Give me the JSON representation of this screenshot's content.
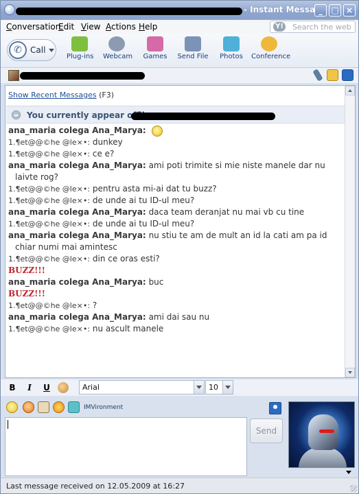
{
  "window": {
    "title": "- Instant Message",
    "controls": {
      "minimize": "_",
      "maximize": "□",
      "close": "×"
    }
  },
  "menu": {
    "items": [
      "Conversation",
      "Edit",
      "View",
      "Actions",
      "Help"
    ],
    "search_placeholder": "Search the web",
    "search_logo": "Y!"
  },
  "toolbar": {
    "call_label": "Call",
    "tools": [
      {
        "label": "Plug-ins",
        "icon": "plugin-icon",
        "color": "#7fbf3f"
      },
      {
        "label": "Webcam",
        "icon": "webcam-icon",
        "color": "#8c9bb0"
      },
      {
        "label": "Games",
        "icon": "games-icon",
        "color": "#d46aa8"
      },
      {
        "label": "Send File",
        "icon": "send-file-icon",
        "color": "#7c93b8"
      },
      {
        "label": "Photos",
        "icon": "photos-icon",
        "color": "#4fb0d8"
      },
      {
        "label": "Conference",
        "icon": "conference-icon",
        "color": "#f0b83a"
      }
    ]
  },
  "conversation": {
    "show_recent_link": "Show Recent Messages",
    "show_recent_key": "(F3)",
    "offline_notice": "You currently appear offli",
    "messages": [
      {
        "sender": "ana_maria colega Ana_Marya:",
        "text": "",
        "smiley": true,
        "who": "them"
      },
      {
        "sender": "1.¶et@@©he @le×•:",
        "text": "dunkey",
        "who": "me"
      },
      {
        "sender": "1.¶et@@©he @le×•:",
        "text": "ce e?",
        "who": "me"
      },
      {
        "sender": "ana_maria colega Ana_Marya:",
        "text": "ami poti trimite si mie niste manele dar nu laivte rog?",
        "who": "them"
      },
      {
        "sender": "1.¶et@@©he @le×•:",
        "text": "pentru asta mi-ai dat tu buzz?",
        "who": "me"
      },
      {
        "sender": "1.¶et@@©he @le×•:",
        "text": "de unde ai tu ID-ul meu?",
        "who": "me"
      },
      {
        "sender": "ana_maria colega Ana_Marya:",
        "text": "daca team deranjat nu mai vb cu tine",
        "who": "them"
      },
      {
        "sender": "1.¶et@@©he @le×•:",
        "text": "de unde ai tu ID-ul meu?",
        "who": "me"
      },
      {
        "sender": "ana_maria colega Ana_Marya:",
        "text": "nu stiu te am de mult an id la cati am pa id chiar numi mai amintesc",
        "who": "them"
      },
      {
        "sender": "1.¶et@@©he @le×•:",
        "text": "din ce oras esti?",
        "who": "me"
      },
      {
        "buzz": "BUZZ!!!"
      },
      {
        "sender": "ana_maria colega Ana_Marya:",
        "text": "buc",
        "who": "them"
      },
      {
        "buzz": "BUZZ!!!"
      },
      {
        "sender": "1.¶et@@©he @le×•:",
        "text": "?",
        "who": "me"
      },
      {
        "sender": "ana_maria colega Ana_Marya:",
        "text": "ami dai sau nu",
        "who": "them"
      },
      {
        "sender": "1.¶et@@©he @le×•:",
        "text": "nu ascult manele",
        "who": "me"
      }
    ]
  },
  "format": {
    "bold": "B",
    "italic": "I",
    "underline": "U",
    "font": "Arial",
    "size": "10"
  },
  "imvironment_label": "IMVironment",
  "send_label": "Send",
  "status": {
    "text": "Last message received on 12.05.2009 at 16:27"
  }
}
